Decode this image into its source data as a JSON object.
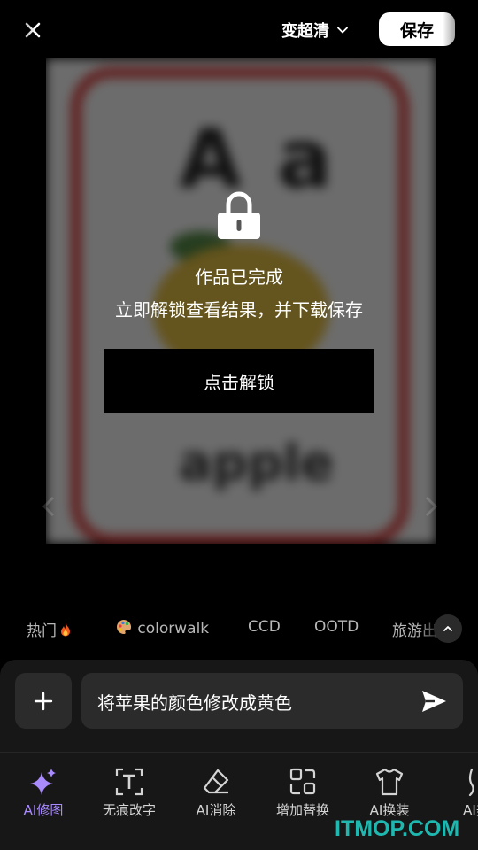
{
  "topbar": {
    "close_icon": "close-icon",
    "quality_label": "变超清",
    "save_label": "保存"
  },
  "preview": {
    "card_letters": "A a",
    "card_word": "apple",
    "lock_icon": "lock-icon",
    "unlock_title": "作品已完成",
    "unlock_subtitle": "立即解锁查看结果，并下载保存",
    "unlock_button": "点击解锁"
  },
  "tags": [
    {
      "label": "热门",
      "emoji": "fire"
    },
    {
      "label": "colorwalk",
      "emoji": "palette"
    },
    {
      "label": "CCD"
    },
    {
      "label": "OOTD"
    },
    {
      "label": "旅游出"
    }
  ],
  "prompt": {
    "text": "将苹果的颜色修改成黄色",
    "add_icon": "plus-icon",
    "send_icon": "send-icon"
  },
  "tools": [
    {
      "label": "AI修图",
      "icon": "sparkle-icon",
      "active": true
    },
    {
      "label": "无痕改字",
      "icon": "text-replace-icon"
    },
    {
      "label": "AI消除",
      "icon": "eraser-icon"
    },
    {
      "label": "增加替换",
      "icon": "shapes-icon"
    },
    {
      "label": "AI换装",
      "icon": "shirt-icon"
    },
    {
      "label": "AI美",
      "icon": "body-icon"
    }
  ],
  "colors": {
    "accent": "#a98bff",
    "watermark": "#1fb8b0"
  },
  "watermark": "ITMOP.COM"
}
